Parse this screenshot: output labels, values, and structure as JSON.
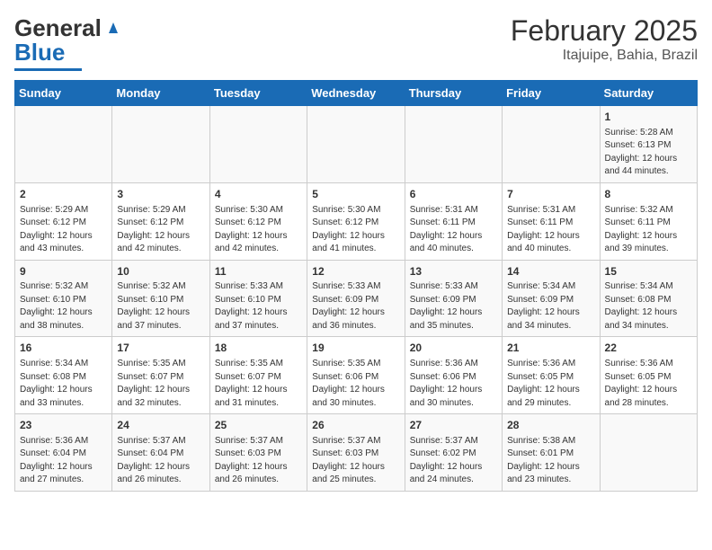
{
  "header": {
    "logo_general": "General",
    "logo_blue": "Blue",
    "title": "February 2025",
    "subtitle": "Itajuipe, Bahia, Brazil"
  },
  "calendar": {
    "days_of_week": [
      "Sunday",
      "Monday",
      "Tuesday",
      "Wednesday",
      "Thursday",
      "Friday",
      "Saturday"
    ],
    "weeks": [
      [
        {
          "day": "",
          "info": ""
        },
        {
          "day": "",
          "info": ""
        },
        {
          "day": "",
          "info": ""
        },
        {
          "day": "",
          "info": ""
        },
        {
          "day": "",
          "info": ""
        },
        {
          "day": "",
          "info": ""
        },
        {
          "day": "1",
          "info": "Sunrise: 5:28 AM\nSunset: 6:13 PM\nDaylight: 12 hours\nand 44 minutes."
        }
      ],
      [
        {
          "day": "2",
          "info": "Sunrise: 5:29 AM\nSunset: 6:12 PM\nDaylight: 12 hours\nand 43 minutes."
        },
        {
          "day": "3",
          "info": "Sunrise: 5:29 AM\nSunset: 6:12 PM\nDaylight: 12 hours\nand 42 minutes."
        },
        {
          "day": "4",
          "info": "Sunrise: 5:30 AM\nSunset: 6:12 PM\nDaylight: 12 hours\nand 42 minutes."
        },
        {
          "day": "5",
          "info": "Sunrise: 5:30 AM\nSunset: 6:12 PM\nDaylight: 12 hours\nand 41 minutes."
        },
        {
          "day": "6",
          "info": "Sunrise: 5:31 AM\nSunset: 6:11 PM\nDaylight: 12 hours\nand 40 minutes."
        },
        {
          "day": "7",
          "info": "Sunrise: 5:31 AM\nSunset: 6:11 PM\nDaylight: 12 hours\nand 40 minutes."
        },
        {
          "day": "8",
          "info": "Sunrise: 5:32 AM\nSunset: 6:11 PM\nDaylight: 12 hours\nand 39 minutes."
        }
      ],
      [
        {
          "day": "9",
          "info": "Sunrise: 5:32 AM\nSunset: 6:10 PM\nDaylight: 12 hours\nand 38 minutes."
        },
        {
          "day": "10",
          "info": "Sunrise: 5:32 AM\nSunset: 6:10 PM\nDaylight: 12 hours\nand 37 minutes."
        },
        {
          "day": "11",
          "info": "Sunrise: 5:33 AM\nSunset: 6:10 PM\nDaylight: 12 hours\nand 37 minutes."
        },
        {
          "day": "12",
          "info": "Sunrise: 5:33 AM\nSunset: 6:09 PM\nDaylight: 12 hours\nand 36 minutes."
        },
        {
          "day": "13",
          "info": "Sunrise: 5:33 AM\nSunset: 6:09 PM\nDaylight: 12 hours\nand 35 minutes."
        },
        {
          "day": "14",
          "info": "Sunrise: 5:34 AM\nSunset: 6:09 PM\nDaylight: 12 hours\nand 34 minutes."
        },
        {
          "day": "15",
          "info": "Sunrise: 5:34 AM\nSunset: 6:08 PM\nDaylight: 12 hours\nand 34 minutes."
        }
      ],
      [
        {
          "day": "16",
          "info": "Sunrise: 5:34 AM\nSunset: 6:08 PM\nDaylight: 12 hours\nand 33 minutes."
        },
        {
          "day": "17",
          "info": "Sunrise: 5:35 AM\nSunset: 6:07 PM\nDaylight: 12 hours\nand 32 minutes."
        },
        {
          "day": "18",
          "info": "Sunrise: 5:35 AM\nSunset: 6:07 PM\nDaylight: 12 hours\nand 31 minutes."
        },
        {
          "day": "19",
          "info": "Sunrise: 5:35 AM\nSunset: 6:06 PM\nDaylight: 12 hours\nand 30 minutes."
        },
        {
          "day": "20",
          "info": "Sunrise: 5:36 AM\nSunset: 6:06 PM\nDaylight: 12 hours\nand 30 minutes."
        },
        {
          "day": "21",
          "info": "Sunrise: 5:36 AM\nSunset: 6:05 PM\nDaylight: 12 hours\nand 29 minutes."
        },
        {
          "day": "22",
          "info": "Sunrise: 5:36 AM\nSunset: 6:05 PM\nDaylight: 12 hours\nand 28 minutes."
        }
      ],
      [
        {
          "day": "23",
          "info": "Sunrise: 5:36 AM\nSunset: 6:04 PM\nDaylight: 12 hours\nand 27 minutes."
        },
        {
          "day": "24",
          "info": "Sunrise: 5:37 AM\nSunset: 6:04 PM\nDaylight: 12 hours\nand 26 minutes."
        },
        {
          "day": "25",
          "info": "Sunrise: 5:37 AM\nSunset: 6:03 PM\nDaylight: 12 hours\nand 26 minutes."
        },
        {
          "day": "26",
          "info": "Sunrise: 5:37 AM\nSunset: 6:03 PM\nDaylight: 12 hours\nand 25 minutes."
        },
        {
          "day": "27",
          "info": "Sunrise: 5:37 AM\nSunset: 6:02 PM\nDaylight: 12 hours\nand 24 minutes."
        },
        {
          "day": "28",
          "info": "Sunrise: 5:38 AM\nSunset: 6:01 PM\nDaylight: 12 hours\nand 23 minutes."
        },
        {
          "day": "",
          "info": ""
        }
      ]
    ]
  }
}
